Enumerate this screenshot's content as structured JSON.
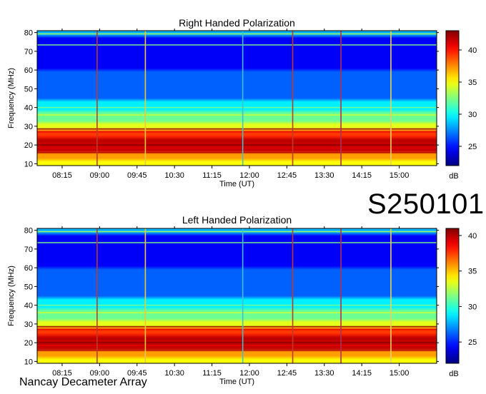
{
  "code_label": "S250101",
  "footer_label": "Nancay Decameter Array",
  "chart_data": [
    {
      "type": "heatmap",
      "title": "Right Handed Polarization",
      "xlabel": "Time (UT)",
      "ylabel": "Frequency (MHz)",
      "x_ticks": [
        "08:15",
        "09:00",
        "09:45",
        "10:30",
        "11:15",
        "12:00",
        "12:45",
        "13:30",
        "14:15",
        "15:00"
      ],
      "x_tick_minutes": [
        495,
        540,
        585,
        630,
        675,
        720,
        765,
        810,
        855,
        900
      ],
      "xlim_minutes": [
        465,
        945
      ],
      "y_ticks": [
        10,
        20,
        30,
        40,
        50,
        60,
        70,
        80
      ],
      "ylim": [
        9,
        81
      ],
      "colorbar": {
        "label": "dB",
        "ticks": [
          25,
          30,
          35,
          40
        ],
        "range": [
          22,
          43
        ]
      },
      "colors": {
        "low": "#00007f",
        "mid": "#21c8ff",
        "high": "#a00000"
      },
      "markers": [
        {
          "minute": 537,
          "color": "#c0392b"
        },
        {
          "minute": 595,
          "color": "#e8c840"
        },
        {
          "minute": 712,
          "color": "#40c0d0"
        },
        {
          "minute": 772,
          "color": "#c0392b"
        },
        {
          "minute": 830,
          "color": "#b03050"
        },
        {
          "minute": 890,
          "color": "#e8d060"
        }
      ]
    },
    {
      "type": "heatmap",
      "title": "Left Handed Polarization",
      "xlabel": "Time (UT)",
      "ylabel": "Frequency (MHz)",
      "x_ticks": [
        "08:15",
        "09:00",
        "09:45",
        "10:30",
        "11:15",
        "12:00",
        "12:45",
        "13:30",
        "14:15",
        "15:00"
      ],
      "x_tick_minutes": [
        495,
        540,
        585,
        630,
        675,
        720,
        765,
        810,
        855,
        900
      ],
      "xlim_minutes": [
        465,
        945
      ],
      "y_ticks": [
        10,
        20,
        30,
        40,
        50,
        60,
        70,
        80
      ],
      "ylim": [
        9,
        81
      ],
      "colorbar": {
        "label": "dB",
        "ticks": [
          25,
          30,
          35,
          40
        ],
        "range": [
          22,
          41
        ]
      },
      "colors": {
        "low": "#00007f",
        "mid": "#21c8ff",
        "high": "#a00000"
      },
      "markers": [
        {
          "minute": 537,
          "color": "#c0392b"
        },
        {
          "minute": 595,
          "color": "#e8c840"
        },
        {
          "minute": 712,
          "color": "#40c0d0"
        },
        {
          "minute": 772,
          "color": "#c0392b"
        },
        {
          "minute": 830,
          "color": "#b03050"
        },
        {
          "minute": 890,
          "color": "#e8d060"
        }
      ]
    }
  ]
}
